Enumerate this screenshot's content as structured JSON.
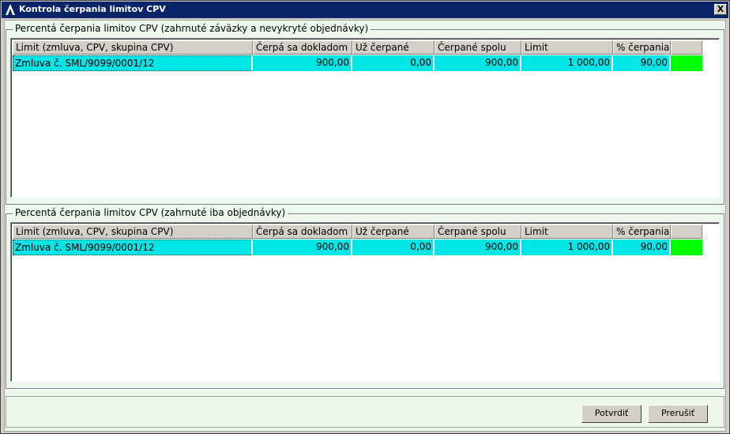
{
  "window": {
    "title": "Kontrola čerpania limitov CPV",
    "close": "X"
  },
  "columns": [
    "Limit (zmluva, CPV, skupina CPV)",
    "Čerpá sa dokladom",
    "Už čerpané",
    "Čerpané spolu",
    "Limit",
    "% čerpania",
    ""
  ],
  "group1": {
    "title": "Percentá čerpania limitov CPV (zahrnuté záväzky a nevykryté objednávky)",
    "rows": [
      {
        "limit": "Zmluva č. SML/9099/0001/12",
        "cerpa": "900,00",
        "uz": "0,00",
        "spolu": "900,00",
        "limit_value": "1 000,00",
        "percent": "90,00",
        "status_color": "#00ff00"
      }
    ]
  },
  "group2": {
    "title": "Percentá čerpania limitov CPV (zahrnuté iba objednávky)",
    "rows": [
      {
        "limit": "Zmluva č. SML/9099/0001/12",
        "cerpa": "900,00",
        "uz": "0,00",
        "spolu": "900,00",
        "limit_value": "1 000,00",
        "percent": "90,00",
        "status_color": "#00ff00"
      }
    ]
  },
  "buttons": {
    "ok": "Potvrdiť",
    "cancel": "Prerušiť"
  }
}
